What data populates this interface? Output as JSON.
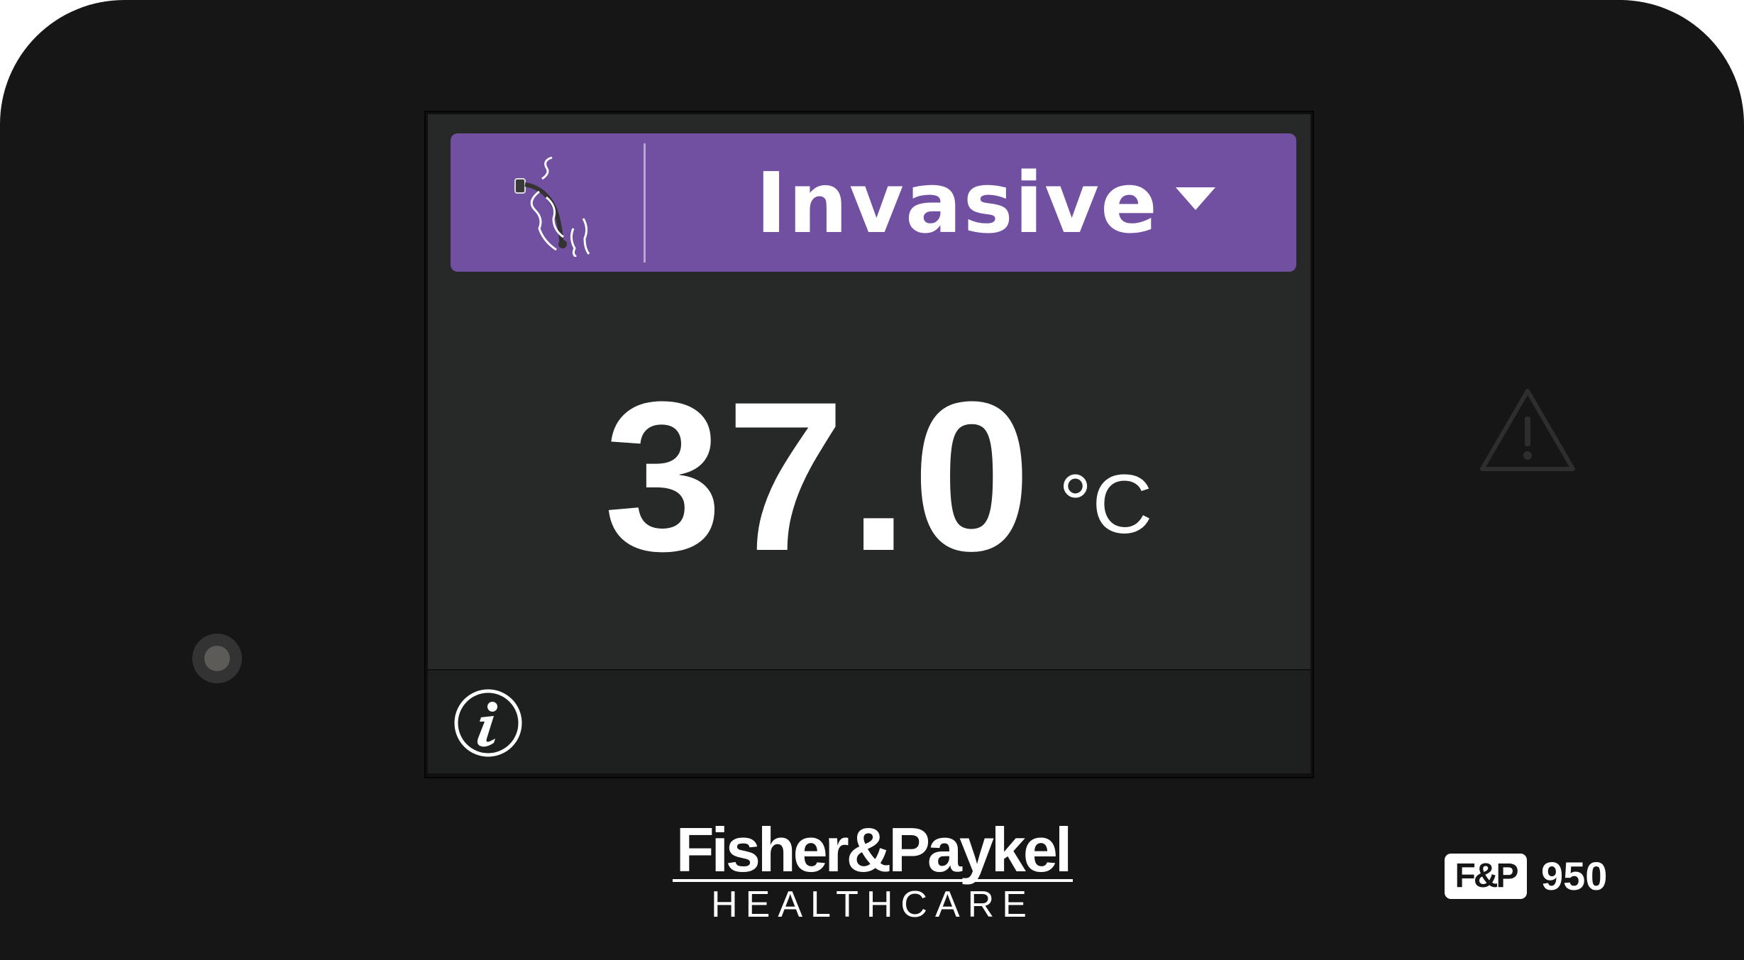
{
  "display": {
    "mode": {
      "label": "Invasive",
      "icon": "airway-breathing-icon",
      "dropdown_icon": "dropdown-arrow-icon"
    },
    "temperature": {
      "value": "37.0",
      "unit": "°C"
    },
    "info_icon": "info-icon"
  },
  "device": {
    "indicator_icon": "status-indicator-light",
    "warning_icon": "warning-triangle-icon",
    "brand_name": "Fisher&Paykel",
    "brand_sub": "HEALTHCARE",
    "model_badge": "F&P",
    "model_number": "950"
  },
  "colors": {
    "body": "#161616",
    "screen_background": "#272828",
    "mode_bar": "#7150a1",
    "text": "#ffffff"
  }
}
